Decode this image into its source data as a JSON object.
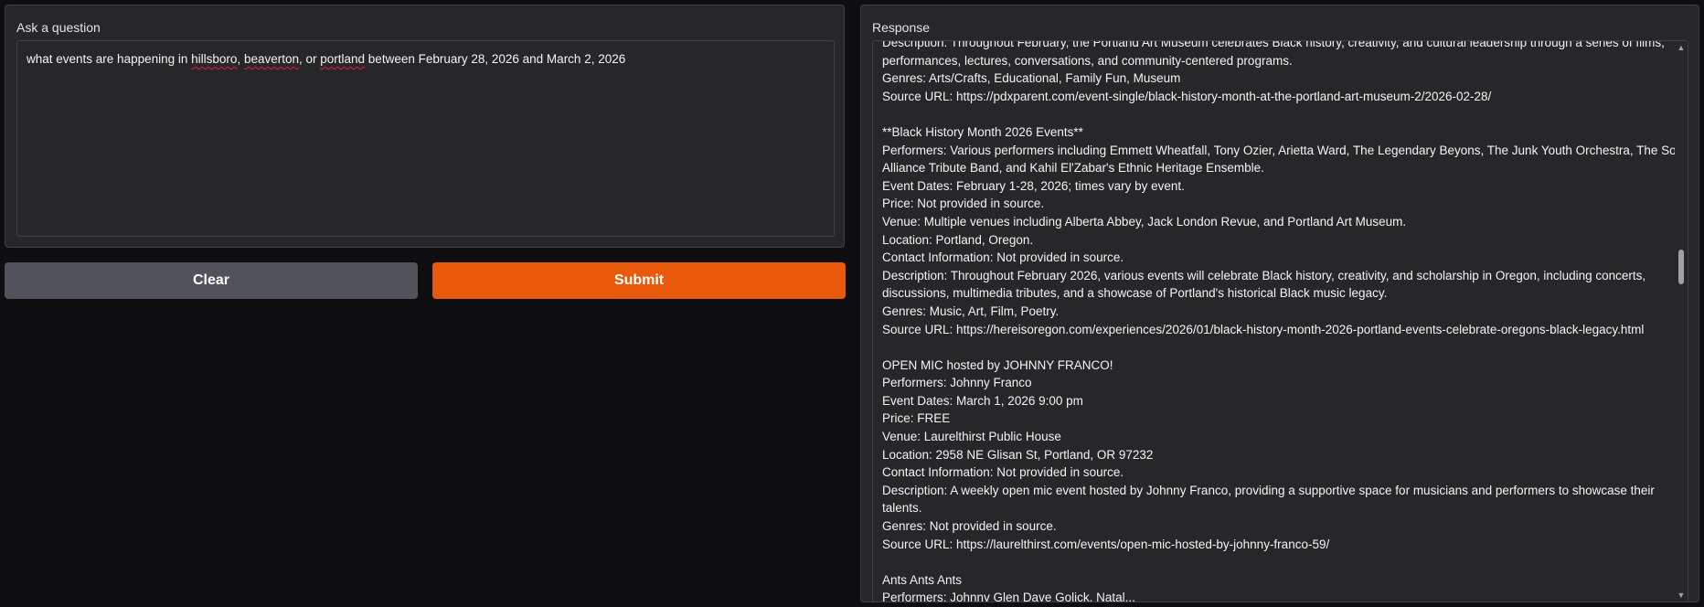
{
  "ask": {
    "label": "Ask a question",
    "question_parts": [
      "what events are happening in ",
      "hillsboro",
      ", ",
      "beaverton",
      ", or ",
      "portland",
      " between February 28, 2026 and March 2, 2026"
    ]
  },
  "buttons": {
    "clear": "Clear",
    "submit": "Submit"
  },
  "response": {
    "label": "Response",
    "lines": [
      "Description: Throughout February, the Portland Art Museum celebrates Black history, creativity, and cultural leadership through a series of films,",
      "performances, lectures, conversations, and community-centered programs.",
      "Genres: Arts/Crafts, Educational, Family Fun, Museum",
      "Source URL: https://pdxparent.com/event-single/black-history-month-at-the-portland-art-museum-2/2026-02-28/",
      "",
      "**Black History Month 2026 Events**",
      "Performers: Various performers including Emmett Wheatfall, Tony Ozier, Arietta Ward, The Legendary Beyons, The Junk Youth Orchestra, The Soul",
      "Alliance Tribute Band, and Kahil El'Zabar's Ethnic Heritage Ensemble.",
      "Event Dates: February 1-28, 2026; times vary by event.",
      "Price: Not provided in source.",
      "Venue: Multiple venues including Alberta Abbey, Jack London Revue, and Portland Art Museum.",
      "Location: Portland, Oregon.",
      "Contact Information: Not provided in source.",
      "Description: Throughout February 2026, various events will celebrate Black history, creativity, and scholarship in Oregon, including concerts,",
      "discussions, multimedia tributes, and a showcase of Portland's historical Black music legacy.",
      "Genres: Music, Art, Film, Poetry.",
      "Source URL: https://hereisoregon.com/experiences/2026/01/black-history-month-2026-portland-events-celebrate-oregons-black-legacy.html",
      "",
      "OPEN MIC hosted by JOHNNY FRANCO!",
      "Performers: Johnny Franco",
      "Event Dates: March 1, 2026 9:00 pm",
      "Price: FREE",
      "Venue: Laurelthirst Public House",
      "Location: 2958 NE Glisan St, Portland, OR 97232",
      "Contact Information: Not provided in source.",
      "Description: A weekly open mic event hosted by Johnny Franco, providing a supportive space for musicians and performers to showcase their",
      "talents.",
      "Genres: Not provided in source.",
      "Source URL: https://laurelthirst.com/events/open-mic-hosted-by-johnny-franco-59/",
      "",
      "Ants Ants Ants",
      "Performers: Johnny Glen Dave Golick, Natal..."
    ]
  },
  "icons": {
    "scroll_up": "triangle-up",
    "scroll_down": "triangle-down"
  },
  "colors": {
    "background": "#0f0f11",
    "panel": "#27272a",
    "submit": "#ea580c",
    "clear": "#52525b"
  }
}
